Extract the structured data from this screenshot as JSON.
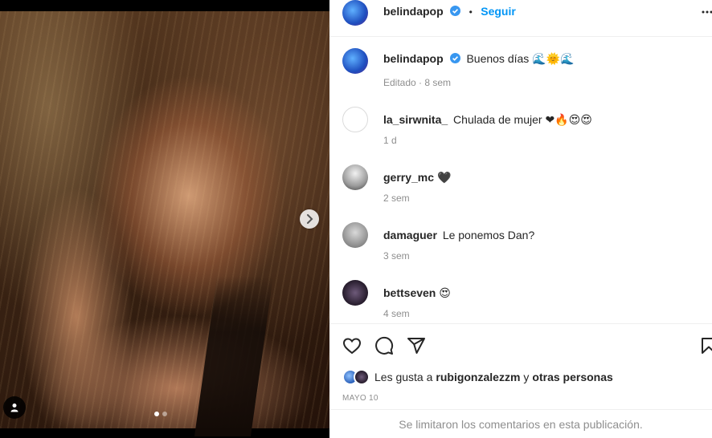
{
  "post": {
    "author": "belindapop",
    "follow_label": "Seguir",
    "separator": "•",
    "caption_text": "Buenos días",
    "caption_emoji": "🌊🌞🌊",
    "caption_meta": "Editado · 8 sem",
    "slide_count": 2,
    "active_slide": 1
  },
  "comments": [
    {
      "user": "la_sirwnita_",
      "text": "Chulada de mujer",
      "emoji": "❤🔥😍😍",
      "time": "1 d",
      "avatar": "blank"
    },
    {
      "user": "gerry_mc",
      "text": "",
      "emoji": "🖤",
      "time": "2 sem",
      "avatar": "mono"
    },
    {
      "user": "damaguer",
      "text": "Le ponemos Dan?",
      "emoji": "",
      "time": "3 sem",
      "avatar": "gray"
    },
    {
      "user": "bettseven",
      "text": "",
      "emoji": "😍",
      "time": "4 sem",
      "avatar": "dark"
    }
  ],
  "likes": {
    "prefix": "Les gusta a",
    "user": "rubigonzalezzm",
    "joiner": "y",
    "others": "otras personas"
  },
  "date": "MAYO 10",
  "comments_limited": "Se limitaron los comentarios en esta publicación.",
  "icons": {
    "verified": "verified-badge-icon",
    "next": "chevron-right-icon",
    "tag": "user-tag-icon",
    "like": "heart-outline-icon",
    "comment": "speech-bubble-icon",
    "share": "paper-plane-icon",
    "save": "bookmark-icon",
    "more": "more-options-icon"
  },
  "colors": {
    "accent": "#0095f6",
    "text": "#262626",
    "secondary": "#8e8e8e",
    "border": "#efefef"
  }
}
